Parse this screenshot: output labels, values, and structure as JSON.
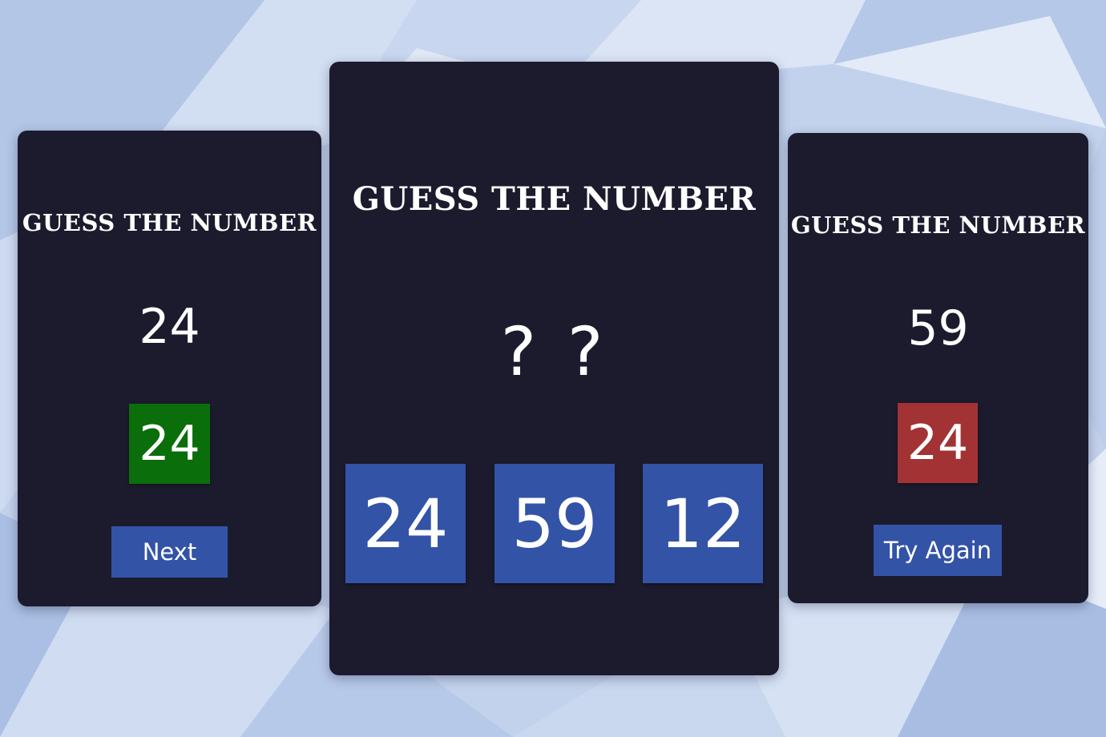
{
  "colors": {
    "background": "#c4d3ec",
    "card": "#1c1b2e",
    "text": "#ffffff",
    "tile_blue": "#3353a7",
    "tile_correct": "#0a6e0a",
    "tile_wrong": "#a23234"
  },
  "left_card": {
    "title": "GUESS THE NUMBER",
    "target_number": "24",
    "selected_answer": "24",
    "result": "correct",
    "button_label": "Next"
  },
  "center_card": {
    "title": "GUESS THE NUMBER",
    "hidden_number": "? ?",
    "choices": [
      "24",
      "59",
      "12"
    ]
  },
  "right_card": {
    "title": "GUESS THE NUMBER",
    "target_number": "59",
    "selected_answer": "24",
    "result": "wrong",
    "button_label": "Try Again"
  }
}
